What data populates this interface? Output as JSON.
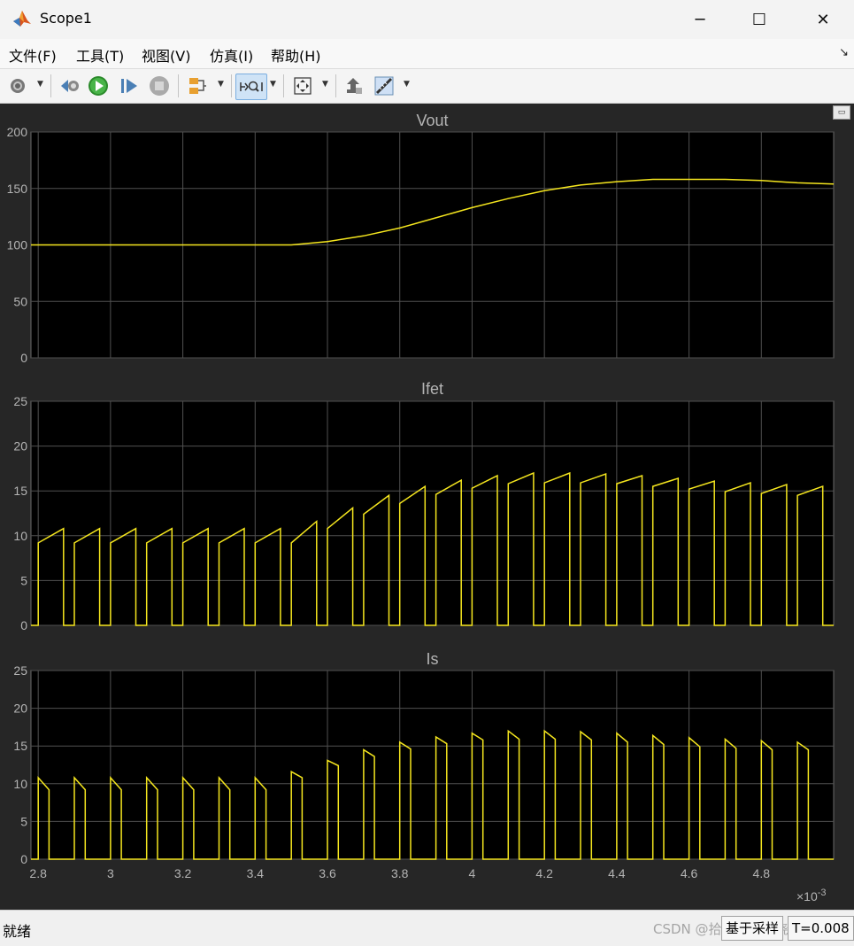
{
  "window": {
    "title": "Scope1"
  },
  "menu": [
    "文件(F)",
    "工具(T)",
    "视图(V)",
    "仿真(I)",
    "帮助(H)"
  ],
  "toolbar": {
    "icons": [
      "gear-icon",
      "step-back-icon",
      "run-icon",
      "step-forward-icon",
      "stop-icon",
      "signal-selector-icon",
      "zoom-icon",
      "fit-to-view-icon",
      "highlight-block-icon",
      "measurement-icon"
    ]
  },
  "colors": {
    "background": "#262626",
    "axes": "#000000",
    "grid": "#505050",
    "trace": "#f5e61e",
    "label": "#b4b4b4"
  },
  "x_ticks": [
    "2.8",
    "3",
    "3.2",
    "3.4",
    "3.6",
    "3.8",
    "4",
    "4.2",
    "4.4",
    "4.6",
    "4.8"
  ],
  "x_exponent": {
    "base": "×10",
    "power": "-3"
  },
  "status": {
    "left": "就绪",
    "mode": "基于采样",
    "time": "T=0.008"
  },
  "watermark": "CSDN @拾贰纸相芸晓儿",
  "chart_data": [
    {
      "type": "line",
      "title": "Vout",
      "xlim": [
        0.00278,
        0.005
      ],
      "ylim": [
        0,
        200
      ],
      "y_ticks": [
        "0",
        "50",
        "100",
        "150",
        "200"
      ],
      "grid": true,
      "series": [
        {
          "x": [
            0.00278,
            0.0029,
            0.003,
            0.0031,
            0.0032,
            0.0033,
            0.0034,
            0.0035,
            0.0036,
            0.0037,
            0.0038,
            0.0039,
            0.004,
            0.0041,
            0.0042,
            0.0043,
            0.0044,
            0.0045,
            0.0046,
            0.0047,
            0.0048,
            0.0049,
            0.005
          ],
          "values": [
            100,
            100,
            100,
            100,
            100,
            100,
            100,
            100,
            103,
            108,
            115,
            124,
            133,
            141,
            148,
            153,
            156,
            158,
            158,
            158,
            157,
            155,
            154
          ]
        }
      ]
    },
    {
      "type": "line",
      "title": "Ifet",
      "xlim": [
        0.00278,
        0.005
      ],
      "ylim": [
        0,
        25
      ],
      "y_ticks": [
        "0",
        "5",
        "10",
        "15",
        "20",
        "25"
      ],
      "grid": true,
      "pulse_period": 0.0001,
      "pulse_duty": 0.7,
      "series": [
        {
          "pulse_start": [
            0.0028,
            0.0029,
            0.003,
            0.0031,
            0.0032,
            0.0033,
            0.0034,
            0.0035,
            0.0036,
            0.0037,
            0.0038,
            0.0039,
            0.004,
            0.0041,
            0.0042,
            0.0043,
            0.0044,
            0.0045,
            0.0046,
            0.0047,
            0.0048,
            0.0049
          ],
          "low": [
            9.2,
            9.2,
            9.2,
            9.2,
            9.2,
            9.2,
            9.2,
            9.2,
            10.8,
            12.4,
            13.6,
            14.6,
            15.3,
            15.8,
            15.9,
            15.9,
            15.8,
            15.5,
            15.2,
            14.9,
            14.7,
            14.5
          ],
          "high": [
            10.8,
            10.8,
            10.8,
            10.8,
            10.8,
            10.8,
            10.8,
            11.6,
            13.1,
            14.5,
            15.5,
            16.2,
            16.7,
            17.0,
            17.0,
            16.9,
            16.7,
            16.4,
            16.1,
            15.9,
            15.7,
            15.5
          ]
        }
      ]
    },
    {
      "type": "line",
      "title": "Is",
      "xlim": [
        0.00278,
        0.005
      ],
      "ylim": [
        0,
        25
      ],
      "y_ticks": [
        "0",
        "5",
        "10",
        "15",
        "20",
        "25"
      ],
      "grid": true,
      "pulse_period": 0.0001,
      "pulse_duty": 0.3,
      "series": [
        {
          "pulse_start": [
            0.0027,
            0.0028,
            0.0029,
            0.003,
            0.0031,
            0.0032,
            0.0033,
            0.0034,
            0.0035,
            0.0036,
            0.0037,
            0.0038,
            0.0039,
            0.004,
            0.0041,
            0.0042,
            0.0043,
            0.0044,
            0.0045,
            0.0046,
            0.0047,
            0.0048,
            0.0049
          ],
          "high": [
            10.8,
            10.8,
            10.8,
            10.8,
            10.8,
            10.8,
            10.8,
            10.8,
            11.6,
            13.1,
            14.5,
            15.5,
            16.2,
            16.7,
            17.0,
            17.0,
            16.9,
            16.7,
            16.4,
            16.1,
            15.9,
            15.7,
            15.5
          ],
          "low": [
            9.2,
            9.2,
            9.2,
            9.2,
            9.2,
            9.2,
            9.2,
            9.2,
            10.8,
            12.4,
            13.6,
            14.6,
            15.3,
            15.8,
            15.9,
            15.9,
            15.8,
            15.5,
            15.2,
            14.9,
            14.7,
            14.5,
            14.5
          ]
        }
      ]
    }
  ]
}
